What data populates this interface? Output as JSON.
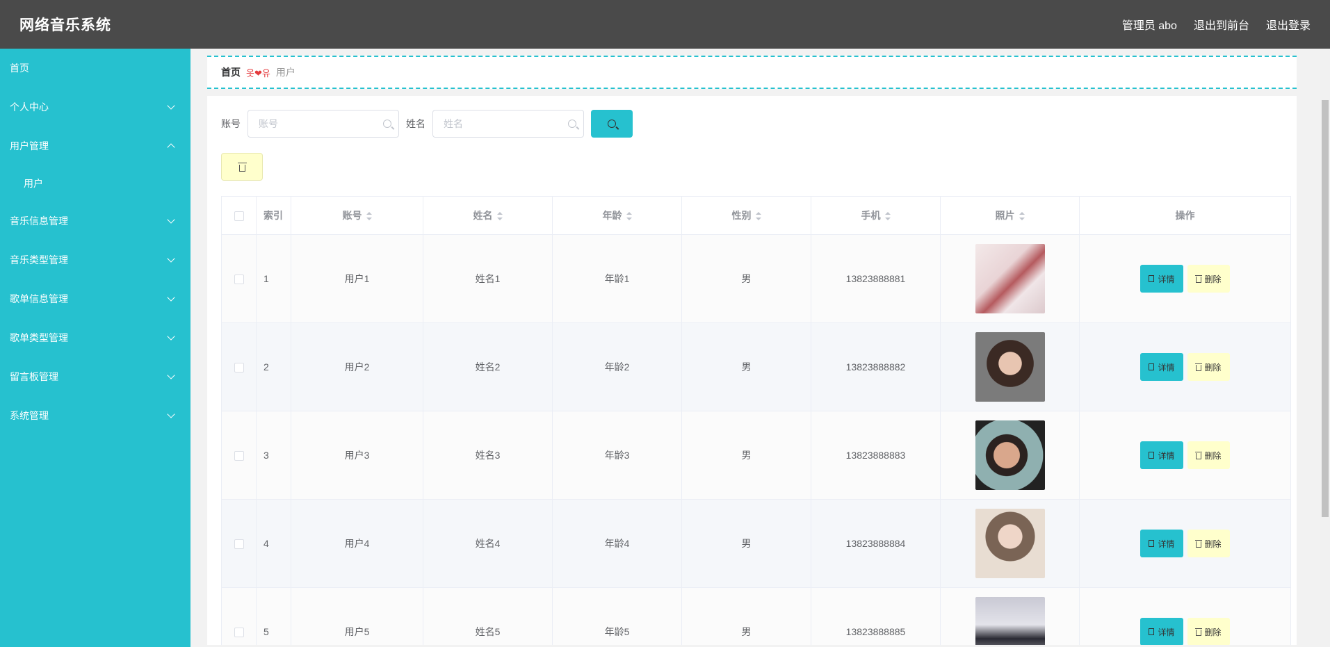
{
  "app": {
    "title": "网络音乐系统"
  },
  "topnav": {
    "admin": "管理员 abo",
    "front": "退出到前台",
    "logout": "退出登录"
  },
  "sidebar": {
    "items": [
      {
        "label": "首页",
        "chevron": "none"
      },
      {
        "label": "个人中心",
        "chevron": "down"
      },
      {
        "label": "用户管理",
        "chevron": "up"
      },
      {
        "label": "用户",
        "chevron": "none",
        "sub": true
      },
      {
        "label": "音乐信息管理",
        "chevron": "down"
      },
      {
        "label": "音乐类型管理",
        "chevron": "down"
      },
      {
        "label": "歌单信息管理",
        "chevron": "down"
      },
      {
        "label": "歌单类型管理",
        "chevron": "down"
      },
      {
        "label": "留言板管理",
        "chevron": "down"
      },
      {
        "label": "系统管理",
        "chevron": "down"
      }
    ]
  },
  "breadcrumb": {
    "home": "首页",
    "sep": "옷❤유",
    "current": "用户"
  },
  "search": {
    "account_label": "账号",
    "account_placeholder": "账号",
    "name_label": "姓名",
    "name_placeholder": "姓名"
  },
  "table": {
    "headers": {
      "index": "索引",
      "account": "账号",
      "name": "姓名",
      "age": "年龄",
      "gender": "性别",
      "phone": "手机",
      "photo": "照片",
      "actions": "操作"
    },
    "detail_label": "详情",
    "delete_label": "删除",
    "rows": [
      {
        "index": "1",
        "account": "用户1",
        "name": "姓名1",
        "age": "年龄1",
        "gender": "男",
        "phone": "13823888881"
      },
      {
        "index": "2",
        "account": "用户2",
        "name": "姓名2",
        "age": "年龄2",
        "gender": "男",
        "phone": "13823888882"
      },
      {
        "index": "3",
        "account": "用户3",
        "name": "姓名3",
        "age": "年龄3",
        "gender": "男",
        "phone": "13823888883"
      },
      {
        "index": "4",
        "account": "用户4",
        "name": "姓名4",
        "age": "年龄4",
        "gender": "男",
        "phone": "13823888884"
      },
      {
        "index": "5",
        "account": "用户5",
        "name": "姓名5",
        "age": "年龄5",
        "gender": "男",
        "phone": "13823888885"
      }
    ]
  },
  "colors": {
    "accent": "#26c1cf",
    "header_bg": "#4a4a4a",
    "delete_bg": "#ffffcc",
    "breadcrumb_sep": "#e4393c"
  }
}
